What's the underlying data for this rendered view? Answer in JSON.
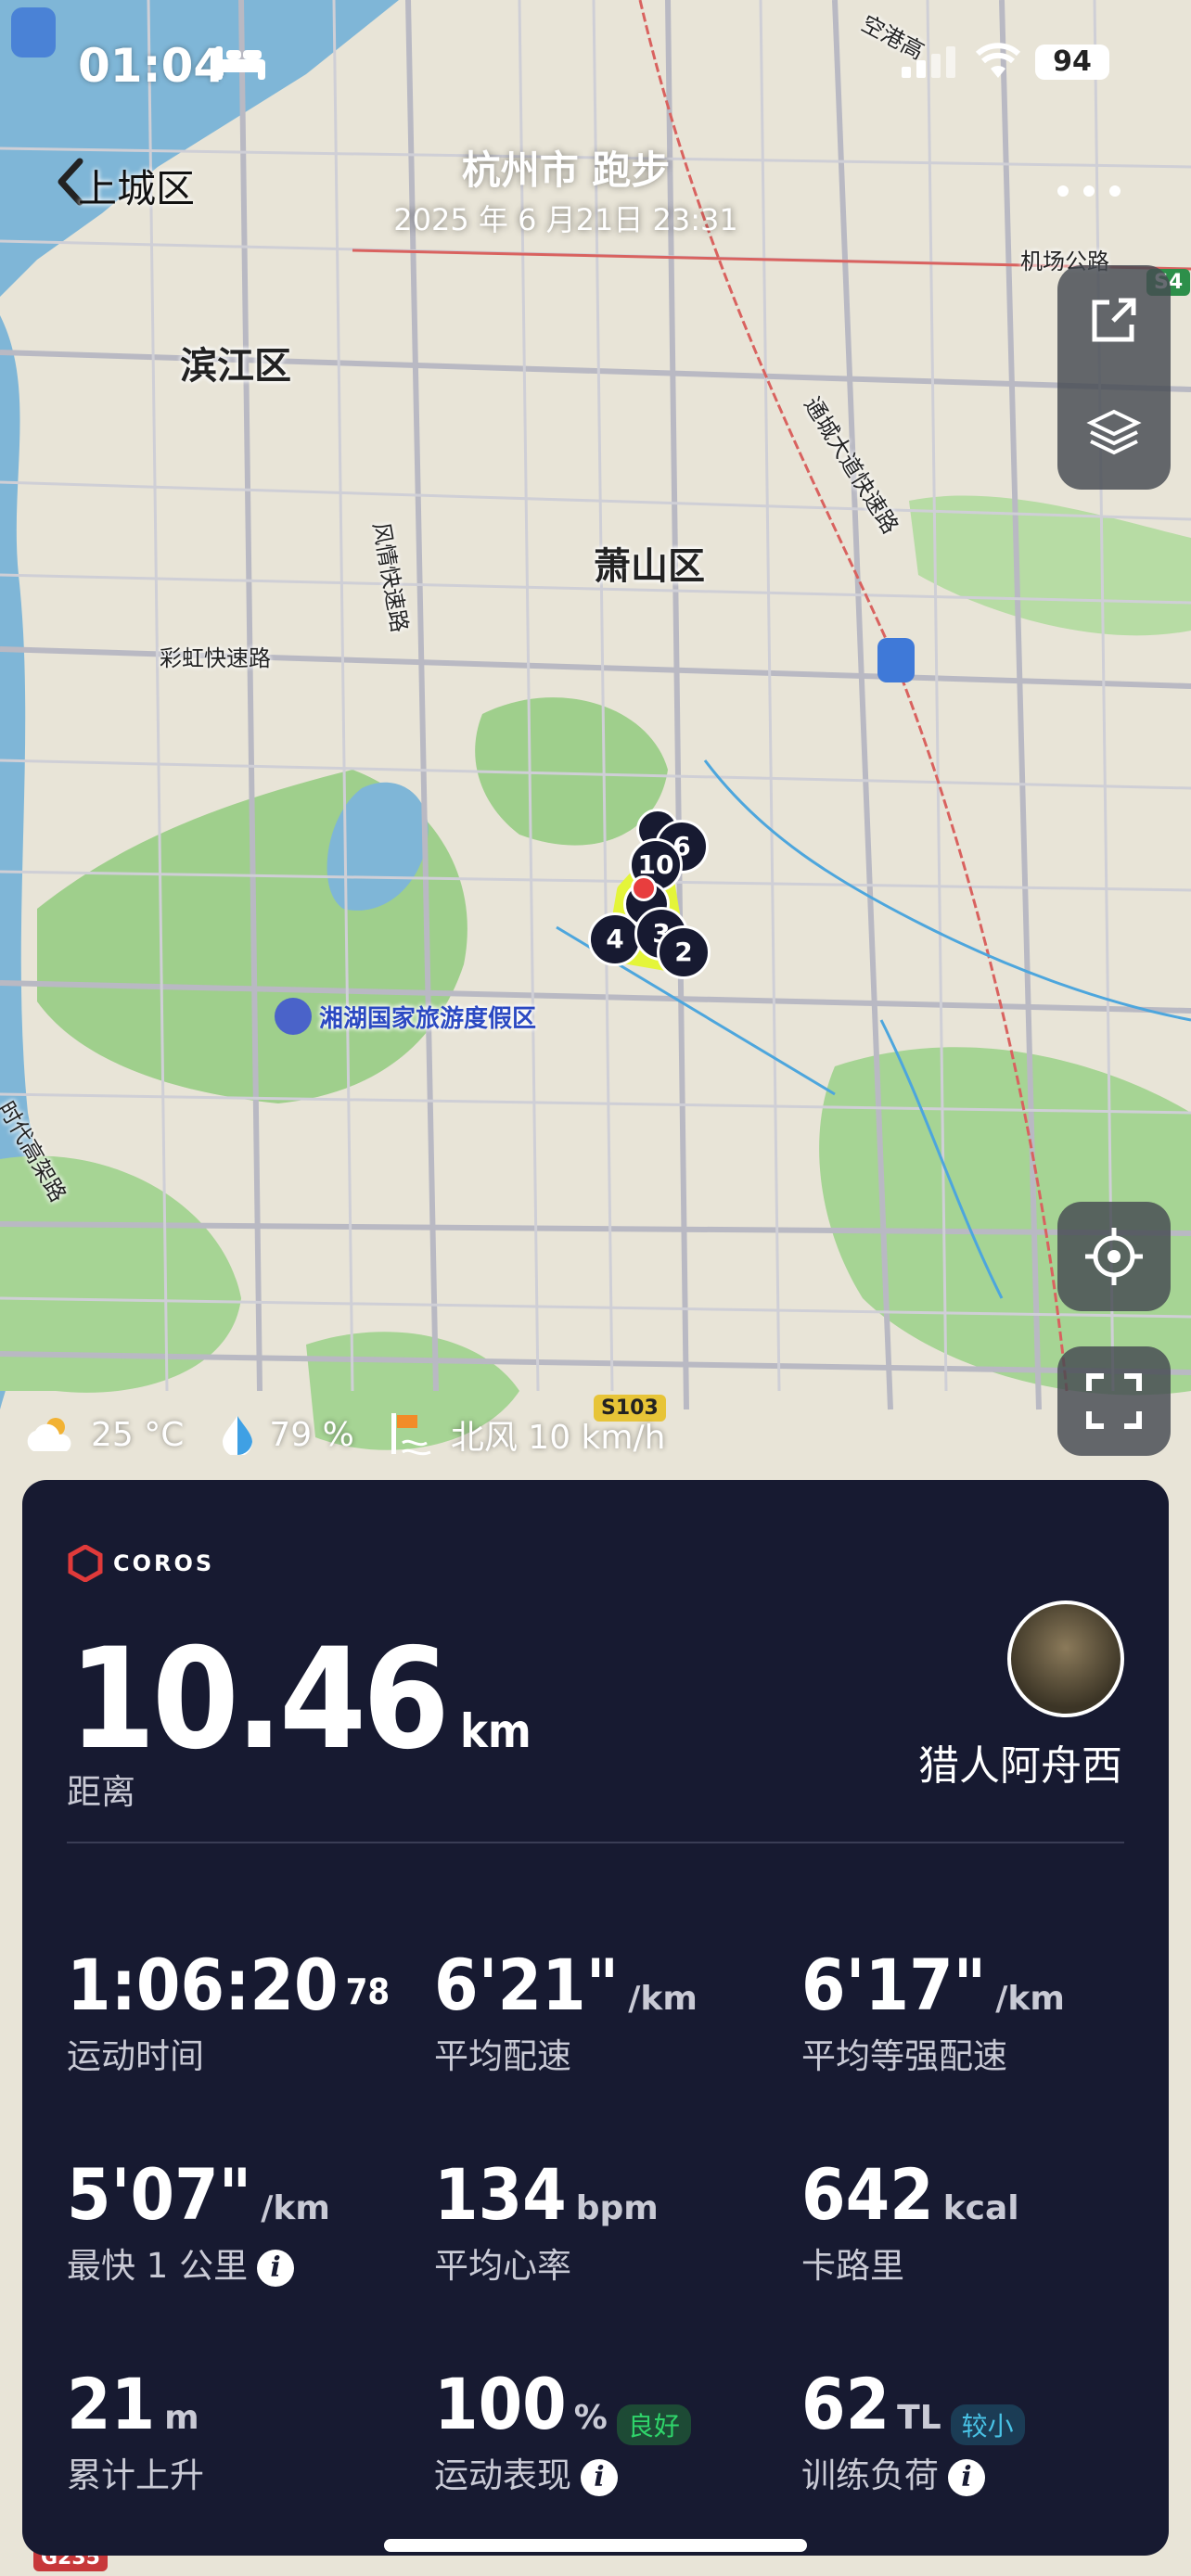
{
  "status_bar": {
    "time": "01:04",
    "battery": "94"
  },
  "header": {
    "back_label": "上城区",
    "title": "杭州市 跑步",
    "subtitle": "2025 年 6 月21日 23:31"
  },
  "map_labels": {
    "binjiang": "滨江区",
    "xiaoshan": "萧山区",
    "airport_road": "机场公路",
    "caihong": "彩虹快速路",
    "fengqing": "风情快速路",
    "tongcheng": "通城大道快速路",
    "konggang": "空港高",
    "xianghu": "湘湖国家旅游度假区",
    "shidai": "时代高架路",
    "s103": "S103",
    "s4": "S4",
    "g235": "G235"
  },
  "route_markers": [
    "10",
    "6",
    "4",
    "3",
    "2"
  ],
  "weather": {
    "temp": "25 °C",
    "humidity": "79 %",
    "wind": "北风 10 km/h"
  },
  "summary": {
    "brand": "COROS",
    "distance_value": "10.46",
    "distance_unit": "km",
    "distance_label": "距离",
    "user_name": "猎人阿舟西"
  },
  "metrics": [
    {
      "value": "1:06:20",
      "sup": "78",
      "unit": "",
      "label": "运动时间"
    },
    {
      "value": "6'21\"",
      "unit": "/km",
      "label": "平均配速"
    },
    {
      "value": "6'17\"",
      "unit": "/km",
      "label": "平均等强配速"
    },
    {
      "value": "5'07\"",
      "unit": "/km",
      "label": "最快 1 公里"
    },
    {
      "value": "134",
      "unit": "bpm",
      "label": "平均心率"
    },
    {
      "value": "642",
      "unit": "kcal",
      "label": "卡路里"
    },
    {
      "value": "21",
      "unit": "m",
      "label": "累计上升"
    },
    {
      "value": "100",
      "unit": "%",
      "badge": "良好",
      "label": "运动表现"
    },
    {
      "value": "62",
      "unit": "TL",
      "badge": "较小",
      "label": "训练负荷"
    }
  ],
  "colors": {
    "card_bg": "#171a31",
    "badge_good": "#2fd46a",
    "badge_low": "#49c3e6",
    "route": "#e4f53a"
  }
}
